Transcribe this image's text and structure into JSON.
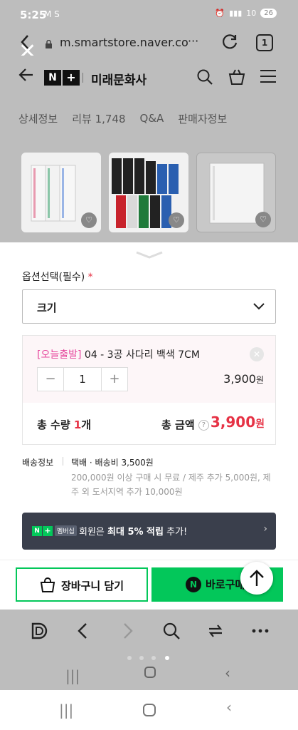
{
  "status_bar": {
    "time": "5:25",
    "extra_text": "M S",
    "right_text": "10",
    "battery": "26"
  },
  "browser": {
    "url": "m.smartstore.naver.co",
    "more_label": "···",
    "tab_count": "1"
  },
  "store": {
    "logo_n": "N",
    "logo_plus": "+",
    "name": "미래문화사"
  },
  "tabs": [
    {
      "label": "상세정보"
    },
    {
      "label": "리뷰 1,748"
    },
    {
      "label": "Q&A"
    },
    {
      "label": "판매자정보"
    }
  ],
  "options": {
    "label": "옵션선택(필수)",
    "required_mark": "*",
    "selected_value": "크기"
  },
  "order_item": {
    "tag": "[오늘출발]",
    "name": "04 - 3공 사다리 백색 7CM",
    "minus": "−",
    "quantity": "1",
    "plus": "+",
    "price": "3,900",
    "price_unit": "원",
    "remove": "✕"
  },
  "totals": {
    "qty_label": "총 수량",
    "qty_value": "1",
    "qty_unit": "개",
    "amount_label": "총 금액",
    "help": "?",
    "amount": "3,900",
    "amount_unit": "원"
  },
  "shipping": {
    "label": "배송정보",
    "main": "택배 · 배송비 3,500원",
    "detail": "200,000원 이상 구매 시 무료 / 제주 추가 5,000원, 제주 외 도서지역 추가 10,000원"
  },
  "banner": {
    "badge_n": "N",
    "badge_plus": "+",
    "badge_membership": "멤버십",
    "text_before": "회원은 ",
    "text_bold": "최대 5% 적립",
    "text_after": " 추가!",
    "arrow": "›"
  },
  "actions": {
    "cart_label": "장바구니 담기",
    "buy_n": "N",
    "buy_label": "바로구매"
  },
  "colors": {
    "naver_green": "#03c75a",
    "price_red": "#e63245",
    "tag_pink": "#e6459c"
  }
}
